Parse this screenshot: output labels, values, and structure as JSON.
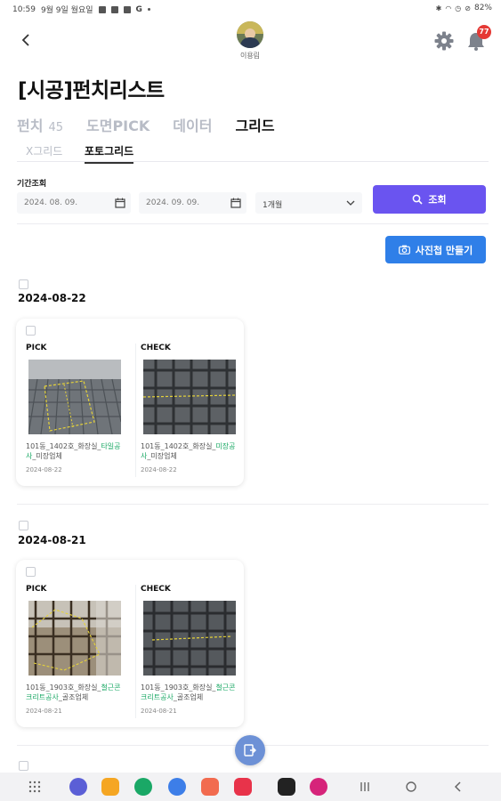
{
  "status_bar": {
    "time": "10:59",
    "date": "9월 9일 월요일",
    "battery": "82%"
  },
  "header": {
    "user_name": "이용림",
    "notification_count": "77"
  },
  "page": {
    "title": "[시공]펀치리스트"
  },
  "tabs": [
    {
      "label": "펀치",
      "count": "45",
      "active": false
    },
    {
      "label": "도면PICK",
      "active": false
    },
    {
      "label": "데이터",
      "active": false
    },
    {
      "label": "그리드",
      "active": true
    }
  ],
  "subtabs": [
    {
      "label": "X그리드",
      "active": false
    },
    {
      "label": "포토그리드",
      "active": true
    }
  ],
  "filter": {
    "period_label": "기간조회",
    "start_date": "2024. 08. 09.",
    "end_date": "2024. 09. 09.",
    "range_value": "1개월",
    "search_label": "조회"
  },
  "album_button_label": "사진첩 만들기",
  "groups": [
    {
      "date": "2024-08-22",
      "pick_label": "PICK",
      "check_label": "CHECK",
      "pick": {
        "caption_plain": "101동_1402호_화장실_",
        "caption_highlight": "타일공사",
        "caption_suffix": "_미장업체",
        "date": "2024-08-22"
      },
      "check": {
        "caption_plain": "101동_1402호_화장실_",
        "caption_highlight": "미장공사",
        "caption_suffix": "_미장업체",
        "date": "2024-08-22"
      }
    },
    {
      "date": "2024-08-21",
      "pick_label": "PICK",
      "check_label": "CHECK",
      "pick": {
        "caption_plain": "101동_1903호_화장실_",
        "caption_highlight": "철근콘크리트공사",
        "caption_suffix": "_골조업체",
        "date": "2024-08-21"
      },
      "check": {
        "caption_plain": "101동_1903호_화장실_",
        "caption_highlight": "철근콘크리트공사",
        "caption_suffix": "_골조업체",
        "date": "2024-08-21"
      }
    }
  ],
  "colors": {
    "primary": "#6a54f0",
    "album": "#2f7fe8",
    "highlight": "#1aa864",
    "badge": "#e53935"
  },
  "icons": {
    "back": "chevron-left-icon",
    "settings": "gear-icon",
    "notifications": "bell-icon",
    "calendar": "calendar-icon",
    "dropdown": "chevron-down-icon",
    "search": "search-icon",
    "camera": "camera-icon",
    "fab": "export-icon"
  }
}
